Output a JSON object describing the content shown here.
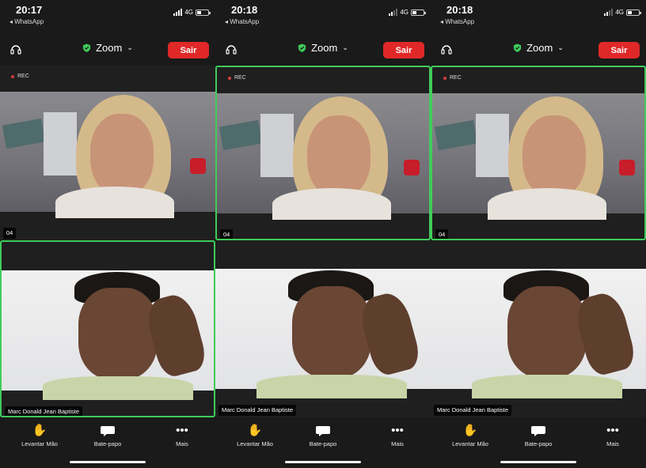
{
  "phones": [
    {
      "time": "20:17",
      "back_app": "◂ WhatsApp",
      "network": "4G",
      "signal_bars": 4,
      "meeting_title": "Zoom",
      "leave_label": "Sair",
      "rec_label": "REC",
      "top_tile_name": "04",
      "bottom_tile_name": "Marc Donald Jean Baptiste",
      "active_speaker": "bottom",
      "controls": [
        {
          "icon": "raise-hand-icon",
          "label": "Levantar Mão"
        },
        {
          "icon": "chat-bubble-icon",
          "label": "Bate-papo"
        },
        {
          "icon": "more-dots-icon",
          "label": "Mais"
        }
      ]
    },
    {
      "time": "20:18",
      "back_app": "◂ WhatsApp",
      "network": "4G",
      "signal_bars": 2,
      "meeting_title": "Zoom",
      "leave_label": "Sair",
      "rec_label": "REC",
      "top_tile_name": "04",
      "bottom_tile_name": "Marc Donald Jean Baptiste",
      "active_speaker": "top",
      "controls": [
        {
          "icon": "raise-hand-icon",
          "label": "Levantar Mão"
        },
        {
          "icon": "chat-bubble-icon",
          "label": "Bate-papo"
        },
        {
          "icon": "more-dots-icon",
          "label": "Mais"
        }
      ]
    },
    {
      "time": "20:18",
      "back_app": "◂ WhatsApp",
      "network": "4G",
      "signal_bars": 2,
      "meeting_title": "Zoom",
      "leave_label": "Sair",
      "rec_label": "REC",
      "top_tile_name": "04",
      "bottom_tile_name": "Marc Donald Jean Baptiste",
      "active_speaker": "top",
      "controls": [
        {
          "icon": "raise-hand-icon",
          "label": "Levantar Mão"
        },
        {
          "icon": "chat-bubble-icon",
          "label": "Bate-papo"
        },
        {
          "icon": "more-dots-icon",
          "label": "Mais"
        }
      ]
    }
  ],
  "colors": {
    "leave_button": "#e02828",
    "active_speaker_border": "#3fcc5a",
    "secure_shield": "#3fcc5a",
    "background": "#1a1a1a"
  }
}
